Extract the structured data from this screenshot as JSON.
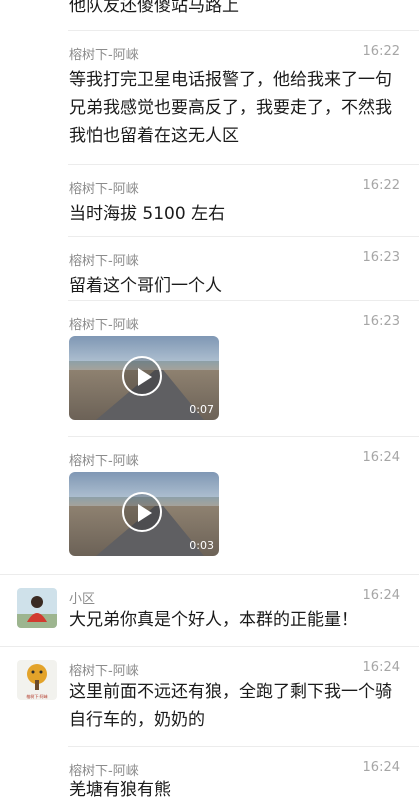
{
  "messages": [
    {
      "text": "他队友还傻傻站马路上"
    },
    {
      "sender": "榕树下-阿崍",
      "time": "16:22",
      "text": "等我打完卫星电话报警了，他给我来了一句兄弟我感觉也要高反了，我要走了，不然我我怕也留着在这无人区"
    },
    {
      "sender": "榕树下-阿崍",
      "time": "16:22",
      "text": "当时海拔 5100 左右"
    },
    {
      "sender": "榕树下-阿崍",
      "time": "16:23",
      "text": "留着这个哥们一个人"
    },
    {
      "sender": "榕树下-阿崍",
      "time": "16:23",
      "video_duration": "0:07"
    },
    {
      "sender": "榕树下-阿崍",
      "time": "16:24",
      "video_duration": "0:03"
    },
    {
      "sender": "小区",
      "time": "16:24",
      "text": "大兄弟你真是个好人，本群的正能量！"
    },
    {
      "sender": "榕树下-阿崍",
      "time": "16:24",
      "text": "这里前面不远还有狼，全跑了剩下我一个骑自行车的，奶奶的"
    },
    {
      "sender": "榕树下-阿崍",
      "time": "16:24",
      "text": "羌塘有狼有熊"
    }
  ],
  "avatars": {
    "xiaoqu": {
      "bg": "#cfe1ea",
      "figure": "#d23a2f"
    },
    "rongshuxia": {
      "bg": "#f2f2ee",
      "tree": "#e3a32a",
      "label": "榕树下·阿崍"
    }
  }
}
